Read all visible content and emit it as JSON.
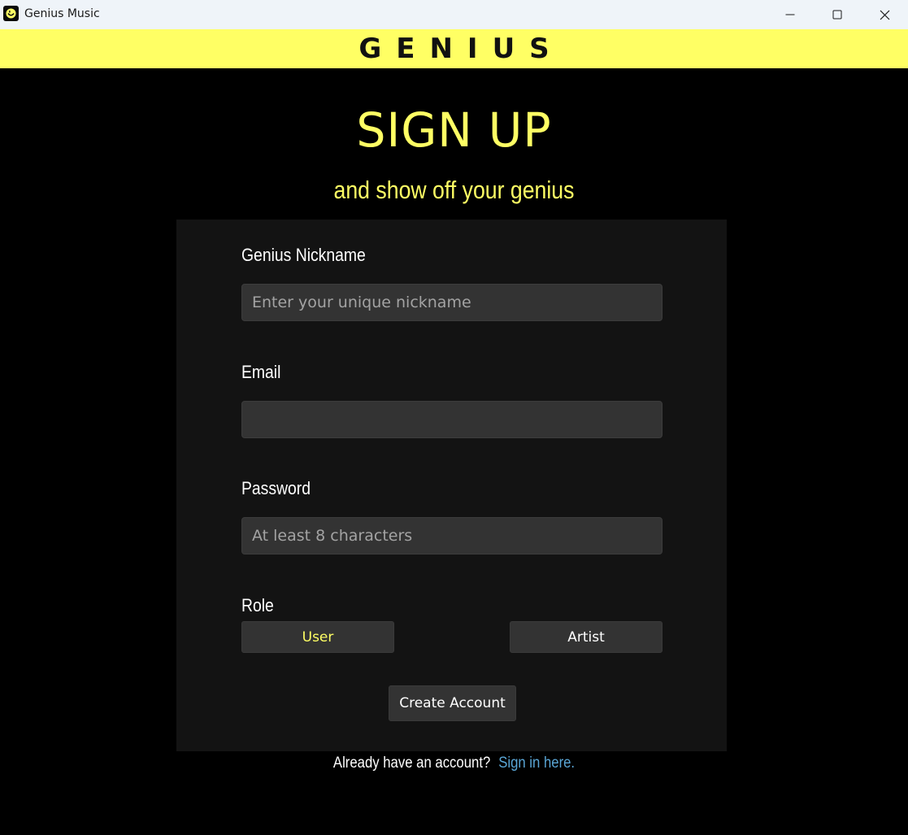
{
  "window": {
    "title": "Genius Music",
    "minimize_icon": "minimize-icon",
    "maximize_icon": "maximize-icon",
    "close_icon": "close-icon"
  },
  "brand": {
    "logo_text": "GENIUS",
    "bar_color": "#ffff64"
  },
  "signup": {
    "heading": "SIGN UP",
    "subheading": "and show off your genius"
  },
  "form": {
    "nickname": {
      "label": "Genius Nickname",
      "value": "",
      "placeholder": "Enter your unique nickname"
    },
    "email": {
      "label": "Email",
      "value": "",
      "placeholder": ""
    },
    "password": {
      "label": "Password",
      "value": "",
      "placeholder": "At least 8 characters"
    },
    "role": {
      "label": "Role",
      "options": [
        "User",
        "Artist"
      ],
      "selected": "User"
    },
    "submit_label": "Create Account"
  },
  "footer": {
    "prompt": "Already have an account?",
    "link_text": "Sign in here."
  },
  "colors": {
    "accent": "#ffff64",
    "background": "#000000",
    "card": "#131313",
    "input": "#333333",
    "link": "#5aa6d6"
  }
}
